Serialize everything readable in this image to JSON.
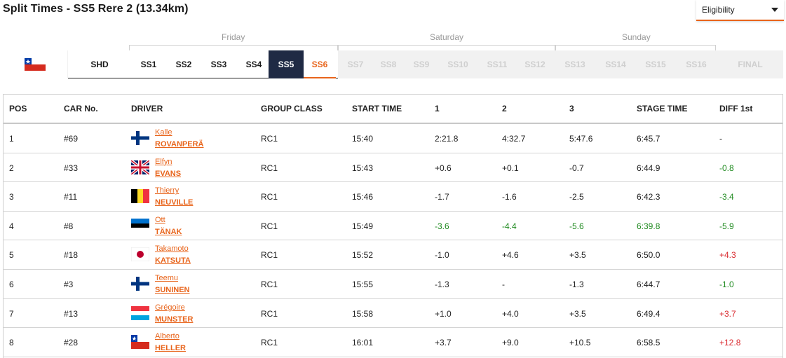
{
  "title": "Split Times - SS5 Rere 2 (13.34km)",
  "eligibility": {
    "label": "Eligibility"
  },
  "days": [
    "Friday",
    "Saturday",
    "Sunday"
  ],
  "stages": [
    {
      "label": "SHD",
      "state": "done"
    },
    {
      "label": "SS1",
      "state": "done"
    },
    {
      "label": "SS2",
      "state": "done"
    },
    {
      "label": "SS3",
      "state": "done"
    },
    {
      "label": "SS4",
      "state": "done"
    },
    {
      "label": "SS5",
      "state": "active"
    },
    {
      "label": "SS6",
      "state": "next"
    },
    {
      "label": "SS7",
      "state": "future"
    },
    {
      "label": "SS8",
      "state": "future"
    },
    {
      "label": "SS9",
      "state": "future"
    },
    {
      "label": "SS10",
      "state": "future"
    },
    {
      "label": "SS11",
      "state": "future"
    },
    {
      "label": "SS12",
      "state": "future"
    },
    {
      "label": "SS13",
      "state": "future"
    },
    {
      "label": "SS14",
      "state": "future"
    },
    {
      "label": "SS15",
      "state": "future"
    },
    {
      "label": "SS16",
      "state": "future"
    },
    {
      "label": "FINAL",
      "state": "future"
    }
  ],
  "columns": {
    "pos": "POS",
    "car": "CAR No.",
    "driver": "DRIVER",
    "group": "GROUP CLASS",
    "start": "START TIME",
    "s1": "1",
    "s2": "2",
    "s3": "3",
    "stage_time": "STAGE TIME",
    "diff": "DIFF 1st"
  },
  "colors": {
    "accent": "#e8641b",
    "active_tab": "#1f2a44",
    "faster": "#1f8a1f",
    "slower": "#d9262b"
  },
  "rows": [
    {
      "pos": "1",
      "car": "#69",
      "first": "Kalle",
      "last": "ROVANPERÄ",
      "flag": "FI",
      "group": "RC1",
      "start": "15:40",
      "s1": "2:21.8",
      "s1_c": "",
      "s2": "4:32.7",
      "s2_c": "",
      "s3": "5:47.6",
      "s3_c": "",
      "stage_time": "6:45.7",
      "st_c": "",
      "diff": "-",
      "diff_c": ""
    },
    {
      "pos": "2",
      "car": "#33",
      "first": "Elfyn",
      "last": "EVANS",
      "flag": "GB",
      "group": "RC1",
      "start": "15:43",
      "s1": "+0.6",
      "s1_c": "",
      "s2": "+0.1",
      "s2_c": "",
      "s3": "-0.7",
      "s3_c": "",
      "stage_time": "6:44.9",
      "st_c": "",
      "diff": "-0.8",
      "diff_c": "green"
    },
    {
      "pos": "3",
      "car": "#11",
      "first": "Thierry",
      "last": "NEUVILLE",
      "flag": "BE",
      "group": "RC1",
      "start": "15:46",
      "s1": "-1.7",
      "s1_c": "",
      "s2": "-1.6",
      "s2_c": "",
      "s3": "-2.5",
      "s3_c": "",
      "stage_time": "6:42.3",
      "st_c": "",
      "diff": "-3.4",
      "diff_c": "green"
    },
    {
      "pos": "4",
      "car": "#8",
      "first": "Ott",
      "last": "TÄNAK",
      "flag": "EE",
      "group": "RC1",
      "start": "15:49",
      "s1": "-3.6",
      "s1_c": "green",
      "s2": "-4.4",
      "s2_c": "green",
      "s3": "-5.6",
      "s3_c": "green",
      "stage_time": "6:39.8",
      "st_c": "green",
      "diff": "-5.9",
      "diff_c": "green"
    },
    {
      "pos": "5",
      "car": "#18",
      "first": "Takamoto",
      "last": "KATSUTA",
      "flag": "JP",
      "group": "RC1",
      "start": "15:52",
      "s1": "-1.0",
      "s1_c": "",
      "s2": "+4.6",
      "s2_c": "",
      "s3": "+3.5",
      "s3_c": "",
      "stage_time": "6:50.0",
      "st_c": "",
      "diff": "+4.3",
      "diff_c": "red"
    },
    {
      "pos": "6",
      "car": "#3",
      "first": "Teemu",
      "last": "SUNINEN",
      "flag": "FI",
      "group": "RC1",
      "start": "15:55",
      "s1": "-1.3",
      "s1_c": "",
      "s2": "-",
      "s2_c": "",
      "s3": "-1.3",
      "s3_c": "",
      "stage_time": "6:44.7",
      "st_c": "",
      "diff": "-1.0",
      "diff_c": "green"
    },
    {
      "pos": "7",
      "car": "#13",
      "first": "Grégoire",
      "last": "MUNSTER",
      "flag": "LU",
      "group": "RC1",
      "start": "15:58",
      "s1": "+1.0",
      "s1_c": "",
      "s2": "+4.0",
      "s2_c": "",
      "s3": "+3.5",
      "s3_c": "",
      "stage_time": "6:49.4",
      "st_c": "",
      "diff": "+3.7",
      "diff_c": "red"
    },
    {
      "pos": "8",
      "car": "#28",
      "first": "Alberto",
      "last": "HELLER",
      "flag": "CL",
      "group": "RC1",
      "start": "16:01",
      "s1": "+3.7",
      "s1_c": "",
      "s2": "+9.0",
      "s2_c": "",
      "s3": "+10.5",
      "s3_c": "",
      "stage_time": "6:58.5",
      "st_c": "",
      "diff": "+12.8",
      "diff_c": "red"
    }
  ]
}
